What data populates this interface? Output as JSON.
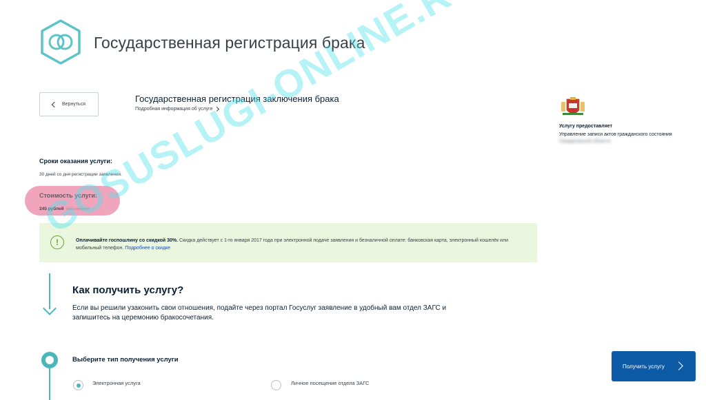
{
  "header": {
    "title": "Государственная регистрация брака",
    "icon": "rings-icon"
  },
  "service": {
    "back_label": "Вернуться",
    "title": "Государственная регистрация заключения брака",
    "more_label": "Подробная информация об услуге"
  },
  "provider": {
    "label": "Услугу предоставляет",
    "name": "Управление записи актов гражданского состояния",
    "name_blurred": "Свердловской области"
  },
  "terms": {
    "title": "Сроки оказания услуги:",
    "value": "30 дней со дня регистрации заявления."
  },
  "cost": {
    "title": "Стоимость услуги:",
    "value": "245 рублей",
    "old_value": "350 рублей"
  },
  "discount": {
    "bold": "Оплачивайте госпошлину со скидкой 30%.",
    "text": " Скидка действует с 1-го января 2017 года при электронной подаче заявления и безналичной оплате: банковская карта, электронный кошелёк или мобильный телефон. ",
    "link": "Подробнее о скидке",
    "icon": "exclamation-icon",
    "color": "#eaf6de"
  },
  "how": {
    "title": "Как получить услугу?",
    "text": "Если вы решили узаконить свои отношения, подайте через портал Госуслуг заявление в удобный вам отдел ЗАГС и запишитесь на церемонию бракосочетания."
  },
  "step": {
    "title": "Выберите тип получения услуги",
    "options": [
      {
        "label": "Электронная услуга",
        "checked": true
      },
      {
        "label": "Личное посещение отдела ЗАГС",
        "checked": false
      }
    ]
  },
  "action": {
    "get_label": "Получить услугу",
    "color": "#0d5aa7"
  },
  "watermark": "GOSUSLUGI-ONLINE.RU",
  "colors": {
    "accent": "#4bb7ba",
    "highlight": "#f0a0b8",
    "link": "#0d4cd3"
  }
}
